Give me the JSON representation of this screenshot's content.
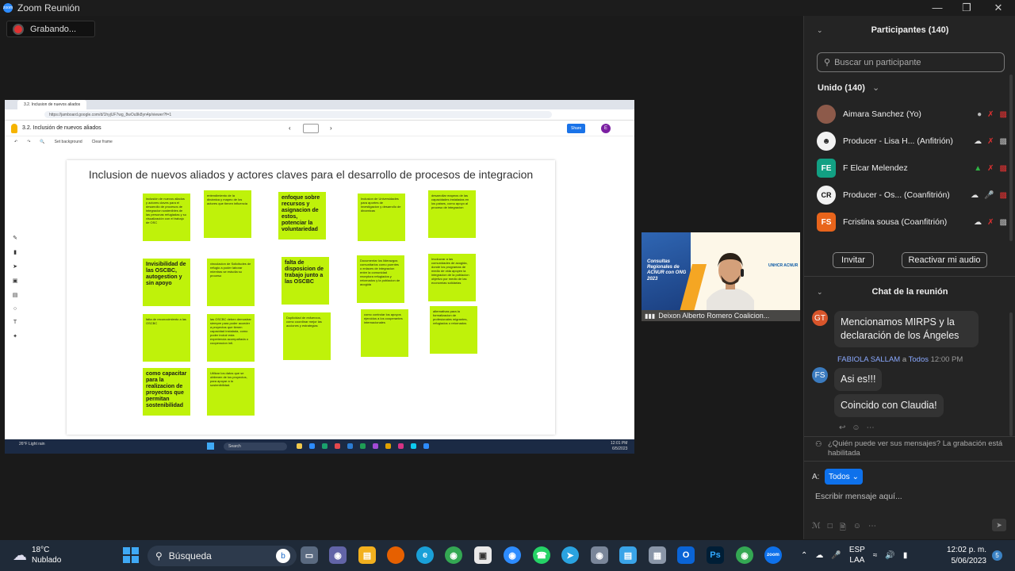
{
  "window": {
    "title": "Zoom Reunión"
  },
  "recording": {
    "label": "Grabando..."
  },
  "shared_screen": {
    "tab_title": "3.2. Inclusion de nuevos aliados",
    "url": "https://jamboard.google.com/d/1hyjUF7wg_8wOu9k8yn4p/viewer?f=1",
    "jam_title": "3.2. Inclusión de nuevos aliados",
    "share_label": "Share",
    "user_initial": "E",
    "tools": {
      "set_background": "Set background",
      "clear_frame": "Clear frame"
    },
    "frame_title": "Inclusion de nuevos aliados y actores claves para el desarrollo de procesos de integracion",
    "notes": [
      {
        "text": "inclusión de nuevos aliados y actores claves para el desarrollo de procesos de integracion sostenibles de las personas refugiadas y su visualización con el trabajo de OSC",
        "big": false
      },
      {
        "text": "entendimiento de la dinámica y mapeo de los actores que tienen influencia",
        "big": false
      },
      {
        "text": "enfoque sobre recursos y asignacion de estos, potenciar la voluntariedad",
        "big": true
      },
      {
        "text": "Inclusion de Universidades para aportes de investigacion y desarrollo de dinamicas",
        "big": false
      },
      {
        "text": "desarrollar mapeos de las capacidades instaladas en los paises, como apoyo al proceso de integracion",
        "big": false
      },
      {
        "text": "Invisibilidad de las OSCBC, autogestion y sin apoyo",
        "big": true
      },
      {
        "text": "vinculacion de Solicitudes de refugio a poder laborar mientras se estudia su proceso",
        "big": false
      },
      {
        "text": "falta de disposicion de trabajo junto a las OSCBC",
        "big": true
      },
      {
        "text": "Documentar los liderazgos comunitarios como puentes o enlaces de integracion entre la comunidad receptora refugiados y retornados y la poblacion de acogida",
        "big": false
      },
      {
        "text": "Involucrar a las comunidades de acogida, donde los programas de medio de vida apoyen la integracion de la poblacion objetivo por medio de las economias solidarias",
        "big": false
      },
      {
        "text": "falta de reconocimiento a las OSCBC",
        "big": false
      },
      {
        "text": "las OSCBC deben demostrar siempre para poder acceder a proyectos que tienen capacidad instalada, como poder incluir esta experiencia acompañada o cooperacion intl.",
        "big": false
      },
      {
        "text": "Duplicidad de esfuerzos, como coordinar mejor las acciones y estrategias",
        "big": false
      },
      {
        "text": "como controlar los apoyos ejercidos a los cooperantes internacionales",
        "big": false
      },
      {
        "text": "alternativas para la formalizacion de profesionales migrantes, refugiados o retornados",
        "big": false
      },
      {
        "text": "como capacitar para la realizacion de proyectos que permitan sostenibilidad",
        "big": true
      },
      {
        "text": "Utilizar los datos que se obtienen de los proyectos, para apoyar a la sostenibilidad.",
        "big": false
      }
    ],
    "taskbar": {
      "weather": "26°F Light rain",
      "search": "Search",
      "time": "12:01 PM",
      "date": "6/5/2023"
    }
  },
  "video": {
    "name": "Deixon Alberto Romero Coalicion...",
    "banner": "Consultas Regionales de ACNUR con ONG 2023",
    "logo": "UNHCR ACNUR"
  },
  "participants": {
    "title": "Participantes (140)",
    "search_placeholder": "Buscar un participante",
    "group": "Unido (140)",
    "list": [
      {
        "name": "Aimara Sanchez (Yo)",
        "initials": "",
        "color": "#8d5a4a"
      },
      {
        "name": "Producer - Lisa H...",
        "role": "(Anfitrión)",
        "initials": "",
        "color": "#f2f2f2"
      },
      {
        "name": "F Elcar Melendez",
        "role": "",
        "initials": "FE",
        "color": "#12a083"
      },
      {
        "name": "Producer - Os...",
        "role": "(Coanfitrión)",
        "initials": "",
        "color": "#f2f2f2"
      },
      {
        "name": "Fcristina sousa",
        "role": "(Coanfitrión)",
        "initials": "FS",
        "color": "#e8641b"
      }
    ],
    "invite_label": "Invitar",
    "unmute_label": "Reactivar mi audio"
  },
  "chat": {
    "title": "Chat de la reunión",
    "messages": [
      {
        "initials": "GT",
        "color": "#d8552b",
        "sender": "",
        "text": "Mencionamos MIRPS y la declaración de los Ángeles"
      },
      {
        "initials": "FS",
        "color": "#3b7bbf",
        "sender": "FABIOLA SALLAM",
        "to": "Todos",
        "time": "12:00 PM",
        "text": "Asi es!!!"
      },
      {
        "initials": "",
        "color": "",
        "sender": "",
        "text": "Coincido con Claudia!"
      }
    ],
    "notice": "¿Quién puede ver sus mensajes? La grabación está habilitada",
    "to_label": "A:",
    "to_value": "Todos",
    "input_placeholder": "Escribir mensaje aquí..."
  },
  "taskbar": {
    "temperature": "18°C",
    "condition": "Nublado",
    "search_label": "Búsqueda",
    "lang1": "ESP",
    "lang2": "LAA",
    "time": "12:02 p. m.",
    "date": "5/06/2023",
    "notifications": "5"
  },
  "colors": {
    "sticky": "#bff20a",
    "zoom_blue": "#0e71eb",
    "mute_red": "#e03131"
  }
}
